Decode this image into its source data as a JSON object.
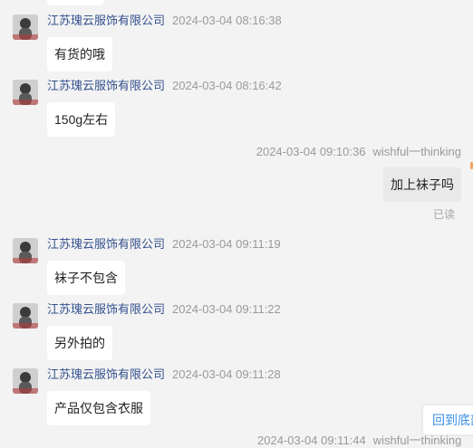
{
  "messages": [
    {
      "sender": "江苏瑰云服饰有限公司",
      "time": "2024-03-04 08:16:38",
      "text": "有货的哦"
    },
    {
      "sender": "江苏瑰云服饰有限公司",
      "time": "2024-03-04 08:16:42",
      "text": "150g左右"
    },
    {
      "sender": "wishful一thinking",
      "time": "2024-03-04 09:10:36",
      "text": "加上袜子吗",
      "status": "已读"
    },
    {
      "sender": "江苏瑰云服饰有限公司",
      "time": "2024-03-04 09:11:19",
      "text": "袜子不包含"
    },
    {
      "sender": "江苏瑰云服饰有限公司",
      "time": "2024-03-04 09:11:22",
      "text": "另外拍的"
    },
    {
      "sender": "江苏瑰云服饰有限公司",
      "time": "2024-03-04 09:11:28",
      "text": "产品仅包含衣服"
    },
    {
      "sender": "wishful一thinking",
      "time": "2024-03-04 09:11:44"
    }
  ],
  "back_to_bottom_label": "回到底部",
  "colors": {
    "sender": "#34518f",
    "time": "#9a9a9a",
    "bubble": "#ffffff",
    "self_bubble": "#e9e9e9",
    "link": "#3b8fe6"
  },
  "icons": {
    "avatar": "shop-avatar-icon"
  }
}
